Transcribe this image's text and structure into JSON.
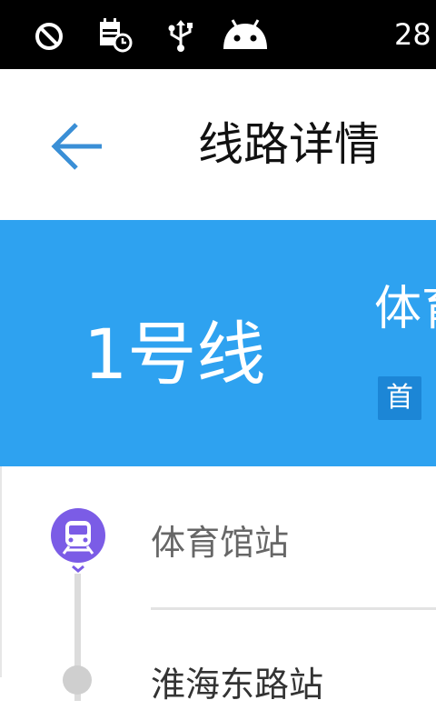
{
  "status_bar": {
    "icons": [
      "block-icon",
      "calendar-clock-icon",
      "usb-icon",
      "android-icon"
    ],
    "time_partial": "28"
  },
  "app_bar": {
    "title": "线路详情",
    "back_icon": "arrow-left-icon"
  },
  "line": {
    "name": "1号线",
    "start_station_partial": "体育",
    "first_badge": "首"
  },
  "stations": [
    {
      "name": "体育馆站",
      "icon": "train-icon"
    },
    {
      "name": "淮海东路站"
    }
  ],
  "colors": {
    "header_blue": "#2ea2f0",
    "badge_blue": "#1c86d6",
    "station_icon_purple": "#7b5ce6",
    "back_arrow": "#3a8fd6"
  }
}
